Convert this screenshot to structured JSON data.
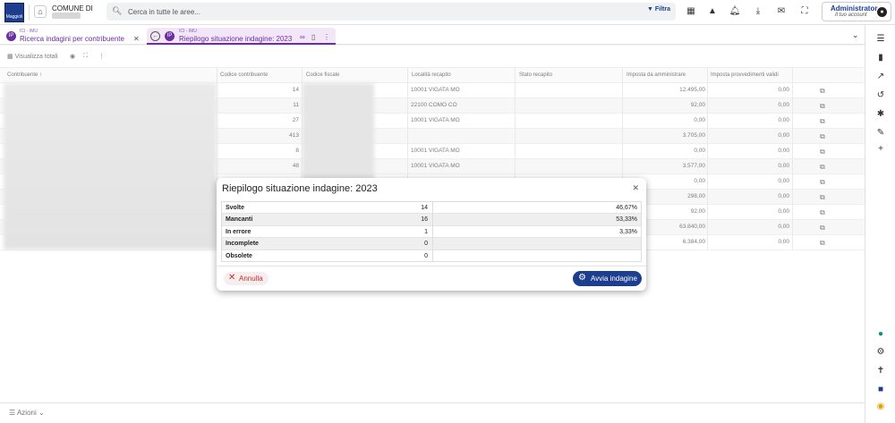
{
  "app": {
    "logo_text": "Maggioli",
    "municipality_label": "COMUNE DI"
  },
  "search": {
    "placeholder": "Cerca in tutte le aree...",
    "filter_label": "Filtra"
  },
  "user": {
    "name": "Administrator",
    "subtitle": "Il tuo account",
    "avatar": "●"
  },
  "tabs": [
    {
      "badge": "IP",
      "super": "ICI - IMU",
      "label": "Ricerca indagini per contribuente"
    },
    {
      "badge": "IP",
      "super": "ICI - IMU",
      "label": "Riepilogo situazione indagine: 2023"
    }
  ],
  "toolbar": {
    "visualizza": "Visualizza totali"
  },
  "table": {
    "headers": [
      "Contribuente",
      "Codice contribuente",
      "Codice fiscale",
      "Località recapito",
      "Stato recapito",
      "Imposta da amministrare",
      "Imposta provvedimenti validi"
    ],
    "rows": [
      {
        "code": "14",
        "loc": "10001 VIGATA MO",
        "imp": "12.495,00",
        "prov": "0,00"
      },
      {
        "code": "11",
        "loc": "22100 COMO CO",
        "imp": "92,00",
        "prov": "0,00"
      },
      {
        "code": "27",
        "loc": "10001 VIGATA MO",
        "imp": "0,00",
        "prov": "0,00"
      },
      {
        "code": "413",
        "loc": "",
        "imp": "3.705,00",
        "prov": "0,00"
      },
      {
        "code": "8",
        "loc": "10001 VIGATA MO",
        "imp": "0,00",
        "prov": "0,00"
      },
      {
        "code": "48",
        "loc": "10001 VIGATA MO",
        "imp": "3.577,00",
        "prov": "0,00"
      },
      {
        "code": "",
        "loc": "",
        "imp": "0,00",
        "prov": "0,00"
      },
      {
        "code": "",
        "loc": "",
        "imp": "298,00",
        "prov": "0,00"
      },
      {
        "code": "",
        "loc": "",
        "imp": "92,00",
        "prov": "0,00"
      },
      {
        "code": "",
        "loc": "",
        "imp": "63.840,00",
        "prov": "0,00"
      },
      {
        "code": "",
        "loc": "",
        "imp": "6.384,00",
        "prov": "0,00"
      }
    ]
  },
  "modal": {
    "title": "Riepilogo situazione indagine: 2023",
    "rows": [
      {
        "label": "Svolte",
        "count": "14",
        "pct": "46,67%"
      },
      {
        "label": "Mancanti",
        "count": "16",
        "pct": "53,33%"
      },
      {
        "label": "In errore",
        "count": "1",
        "pct": "3,33%"
      },
      {
        "label": "Incomplete",
        "count": "0",
        "pct": ""
      },
      {
        "label": "Obsolete",
        "count": "0",
        "pct": ""
      }
    ],
    "cancel_label": "Annulla",
    "start_label": "Avvia indagine"
  },
  "bottom": {
    "actions_label": "Azioni"
  },
  "colors": {
    "primary": "#1d3d8f",
    "tab_accent": "#6b2fa0",
    "danger": "#c43030"
  }
}
